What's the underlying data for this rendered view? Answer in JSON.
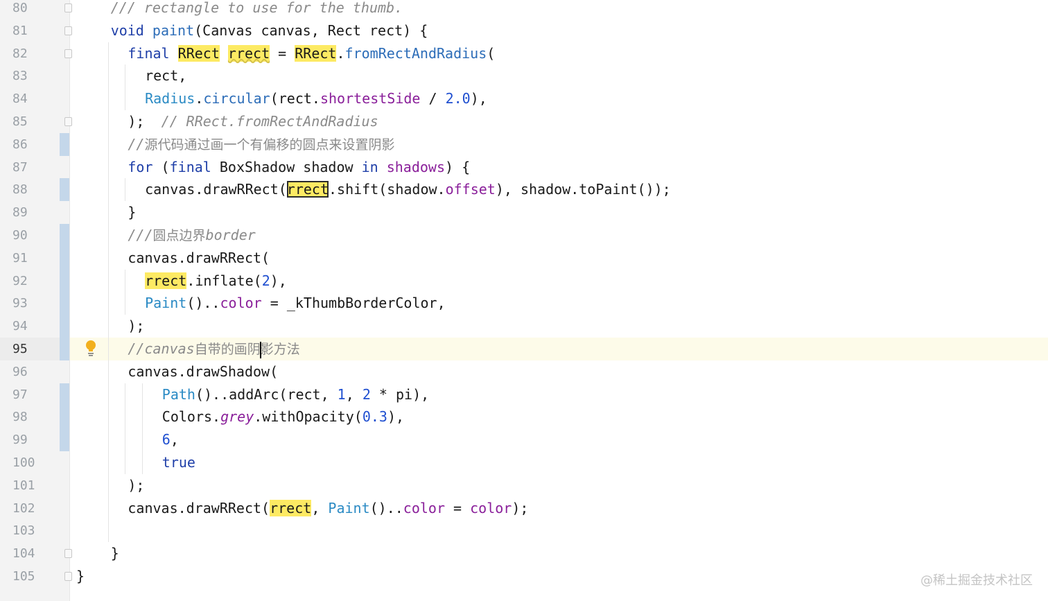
{
  "editor": {
    "lines": [
      {
        "num": "80",
        "text": "/// rectangle to use for the thumb."
      },
      {
        "num": "81",
        "text": "void paint(Canvas canvas, Rect rect) {"
      },
      {
        "num": "82",
        "text": "final RRect rrect = RRect.fromRectAndRadius("
      },
      {
        "num": "83",
        "text": "rect,"
      },
      {
        "num": "84",
        "text": "Radius.circular(rect.shortestSide / 2.0),"
      },
      {
        "num": "85",
        "text": ");  // RRect.fromRectAndRadius"
      },
      {
        "num": "86",
        "text": "//源代码通过画一个有偏移的圆点来设置阴影"
      },
      {
        "num": "87",
        "text": "for (final BoxShadow shadow in shadows) {"
      },
      {
        "num": "88",
        "text": "canvas.drawRRect(rrect.shift(shadow.offset), shadow.toPaint());"
      },
      {
        "num": "89",
        "text": "}"
      },
      {
        "num": "90",
        "text": "///圆点边界border"
      },
      {
        "num": "91",
        "text": "canvas.drawRRect("
      },
      {
        "num": "92",
        "text": "rrect.inflate(2),"
      },
      {
        "num": "93",
        "text": "Paint()..color = _kThumbBorderColor,"
      },
      {
        "num": "94",
        "text": ");"
      },
      {
        "num": "95",
        "text": "//canvas自带的画阴影方法"
      },
      {
        "num": "96",
        "text": "canvas.drawShadow("
      },
      {
        "num": "97",
        "text": "Path()..addArc(rect, 1, 2 * pi),"
      },
      {
        "num": "98",
        "text": "Colors.grey.withOpacity(0.3),"
      },
      {
        "num": "99",
        "text": "6,"
      },
      {
        "num": "100",
        "text": "true"
      },
      {
        "num": "101",
        "text": ");"
      },
      {
        "num": "102",
        "text": "canvas.drawRRect(rrect, Paint()..color = color);"
      },
      {
        "num": "103",
        "text": ""
      },
      {
        "num": "104",
        "text": "}"
      },
      {
        "num": "105",
        "text": "}"
      }
    ],
    "caret_line": "95",
    "intention_icon": "lightbulb-icon"
  },
  "watermark": "@稀土掘金技术社区",
  "colors": {
    "keyword": "#1f3fa8",
    "function": "#2d6db8",
    "class": "#2a8ac4",
    "field": "#8a1f9a",
    "number": "#1f4fd0",
    "comment": "#8a8a8a",
    "highlight": "#fdea63",
    "vcs_changed": "#c4d7ea",
    "caret_row": "#fdfbe9"
  }
}
